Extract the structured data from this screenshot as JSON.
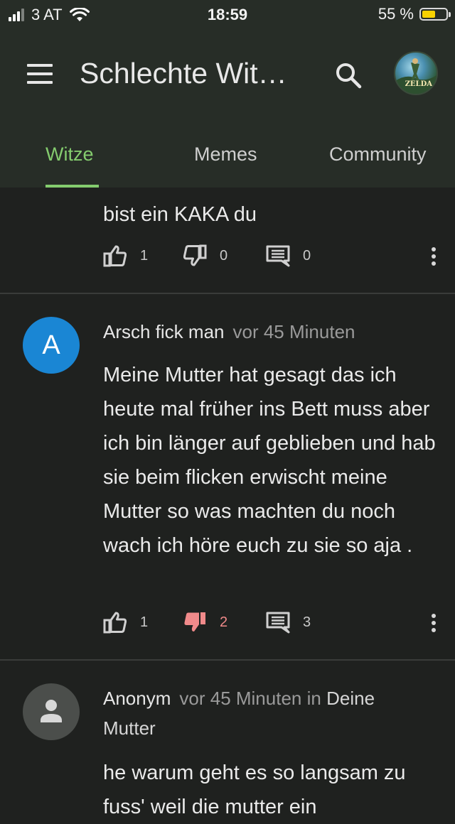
{
  "status_bar": {
    "carrier": "3 AT",
    "time": "18:59",
    "battery": "55 %"
  },
  "app_bar": {
    "title": "Schlechte Wit…",
    "avatar_logo": "ZELDA"
  },
  "tabs": [
    {
      "label": "Witze",
      "active": true
    },
    {
      "label": "Memes",
      "active": false
    },
    {
      "label": "Community",
      "active": false
    }
  ],
  "posts": [
    {
      "text": "bist ein KAKA du",
      "likes": "1",
      "dislikes": "0",
      "comments": "0"
    },
    {
      "avatar_letter": "A",
      "author": "Arsch fick man",
      "time": "vor 45 Minuten",
      "text": "Meine Mutter hat gesagt das ich heute mal früher ins Bett muss aber ich bin länger auf geblieben und hab sie beim flicken erwischt meine Mutter so was machten du noch wach ich höre euch zu sie so aja .",
      "likes": "1",
      "dislikes": "2",
      "comments": "3"
    },
    {
      "author": "Anonym",
      "time": "vor 45 Minuten",
      "in_word": "in",
      "category": "Deine Mutter",
      "text": "he warum geht es so langsam zu fuss' weil die mutter ein"
    }
  ],
  "colors": {
    "accent": "#84cc6e",
    "header_bg": "#272d27",
    "page_bg": "#1f211f",
    "avatar_blue": "#1a86d4",
    "dislike_active": "#f08a8a"
  },
  "icons": [
    "menu-icon",
    "search-icon",
    "thumb-up-icon",
    "thumb-down-icon",
    "comment-icon",
    "more-vert-icon",
    "person-icon"
  ]
}
